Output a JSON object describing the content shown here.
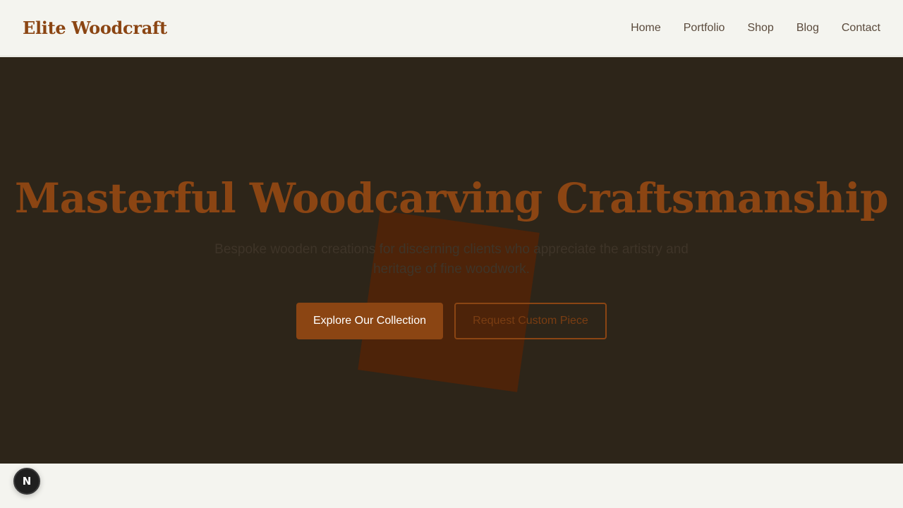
{
  "header": {
    "brand": "Elite Woodcraft",
    "nav": [
      {
        "label": "Home"
      },
      {
        "label": "Portfolio"
      },
      {
        "label": "Shop"
      },
      {
        "label": "Blog"
      },
      {
        "label": "Contact"
      }
    ]
  },
  "hero": {
    "title": "Masterful Woodcarving Craftsmanship",
    "subtitle": "Bespoke wooden creations for discerning clients who appreciate the artistry and heritage of fine woodwork.",
    "primary_cta": "Explore Our Collection",
    "secondary_cta": "Request Custom Piece"
  },
  "dev_badge": {
    "letter": "N",
    "icon": "nextjs-logo-icon"
  },
  "colors": {
    "brand": "#8b4513",
    "hero_background": "#2d2519",
    "page_background": "#f4f4ef",
    "nav_text": "#5a4a3c"
  }
}
